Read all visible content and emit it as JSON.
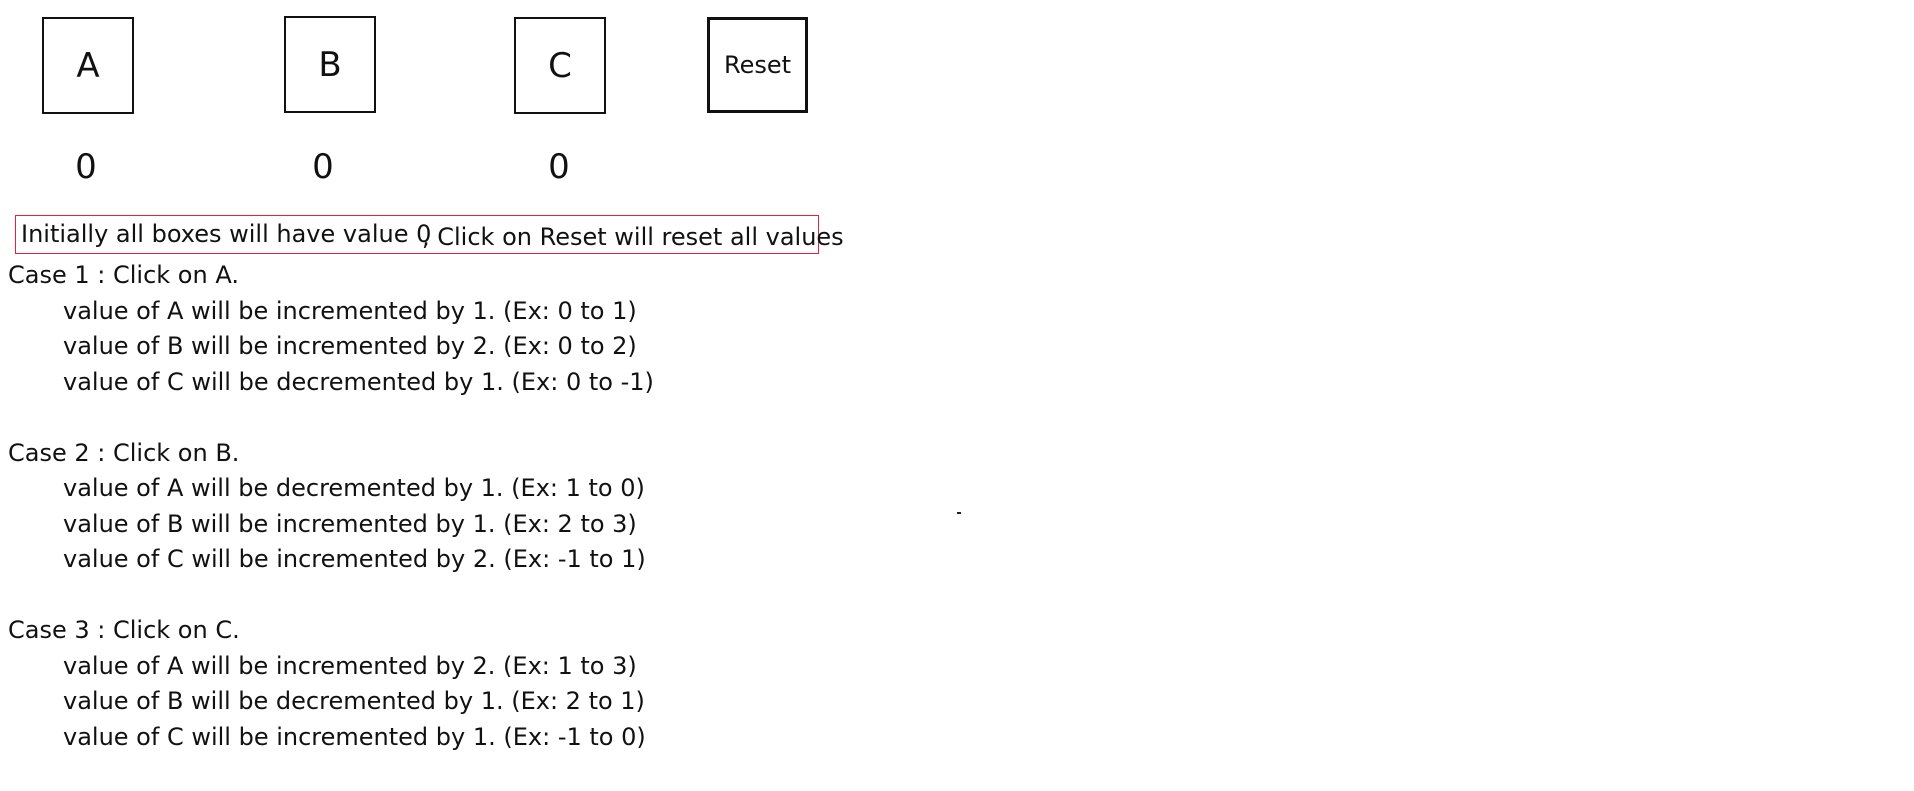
{
  "boxes": [
    {
      "label": "A",
      "value": "0"
    },
    {
      "label": "B",
      "value": "0"
    },
    {
      "label": "C",
      "value": "0"
    }
  ],
  "reset": {
    "label": "Reset"
  },
  "note": {
    "part1": "Initially all boxes will have value 0",
    "part2": ", Click on Reset will reset all values"
  },
  "cases": [
    {
      "title": "Case 1 : Click on A.",
      "lines": [
        "value of A will be incremented by 1.  (Ex: 0 to 1)",
        "value of B will be incremented by 2.  (Ex: 0 to 2)",
        "value of C will be decremented by 1.  (Ex: 0 to -1)"
      ]
    },
    {
      "title": "Case 2 : Click on B.",
      "lines": [
        "value of A will be decremented by 1.  (Ex: 1 to 0)",
        "value of B will be incremented by 1.  (Ex: 2 to 3)",
        "value of C will be incremented by 2.  (Ex: -1 to 1)"
      ]
    },
    {
      "title": "Case 3 : Click on C.",
      "lines": [
        "value of A will be incremented by 2.  (Ex: 1 to 3)",
        "value of B will be decremented by 1.  (Ex: 2 to 1)",
        "value of C will be incremented by 1.  (Ex: -1 to 0)"
      ]
    }
  ]
}
